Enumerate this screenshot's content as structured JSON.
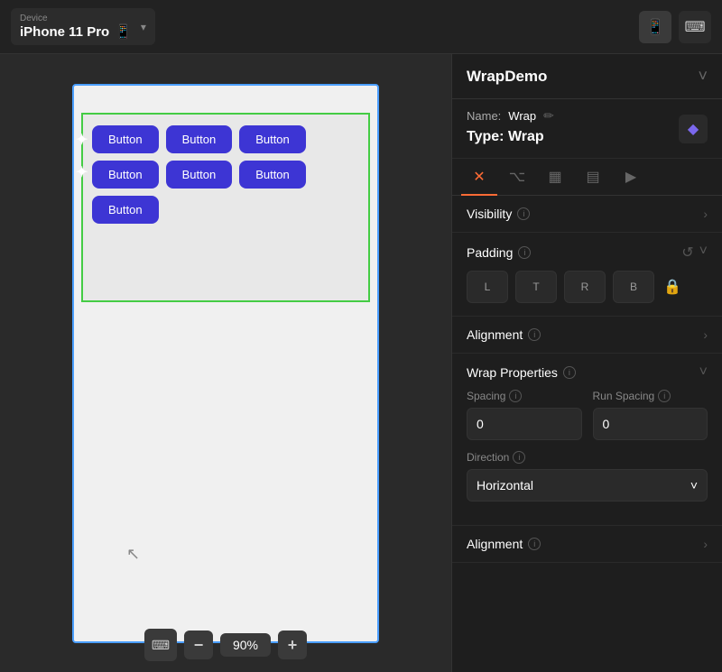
{
  "topbar": {
    "device_label": "Device",
    "device_name": "iPhone 11 Pro",
    "phone_icon": "📱",
    "chevron": "▾",
    "phone_frame_icon": "⬜",
    "keyboard_icon": "⌨"
  },
  "canvas": {
    "buttons": [
      "Button",
      "Button",
      "Button",
      "Button",
      "Button",
      "Button",
      "Button"
    ],
    "zoom_label": "90%",
    "zoom_minus": "−",
    "zoom_plus": "+"
  },
  "panel": {
    "title": "WrapDemo",
    "chevron_icon": "˅",
    "name_label": "Name:",
    "name_value": "Wrap",
    "type_label": "Type:",
    "type_value": "Wrap",
    "edit_icon": "✏",
    "diamond_icon": "◆",
    "tabs": [
      {
        "id": "properties",
        "icon": "⚙",
        "active": true
      },
      {
        "id": "tree",
        "icon": "⌥"
      },
      {
        "id": "grid",
        "icon": "▦"
      },
      {
        "id": "layout",
        "icon": "▤"
      },
      {
        "id": "play",
        "icon": "▶"
      }
    ],
    "visibility": {
      "label": "Visibility",
      "info": "i",
      "arrow": "›"
    },
    "padding": {
      "label": "Padding",
      "info": "i",
      "reset_icon": "↺",
      "expand_icon": "˅",
      "inputs": [
        "L",
        "T",
        "R",
        "B"
      ]
    },
    "alignment": {
      "label": "Alignment",
      "info": "i",
      "arrow": "›"
    },
    "wrap_properties": {
      "label": "Wrap Properties",
      "info": "i",
      "chevron": "˅",
      "spacing_label": "Spacing",
      "spacing_value": "0",
      "run_spacing_label": "Run Spacing",
      "run_spacing_value": "0",
      "direction_label": "Direction",
      "direction_value": "Horizontal",
      "direction_chevron": "˅"
    },
    "bottom_alignment": {
      "label": "Alignment",
      "info": "i",
      "arrow": "›"
    }
  }
}
